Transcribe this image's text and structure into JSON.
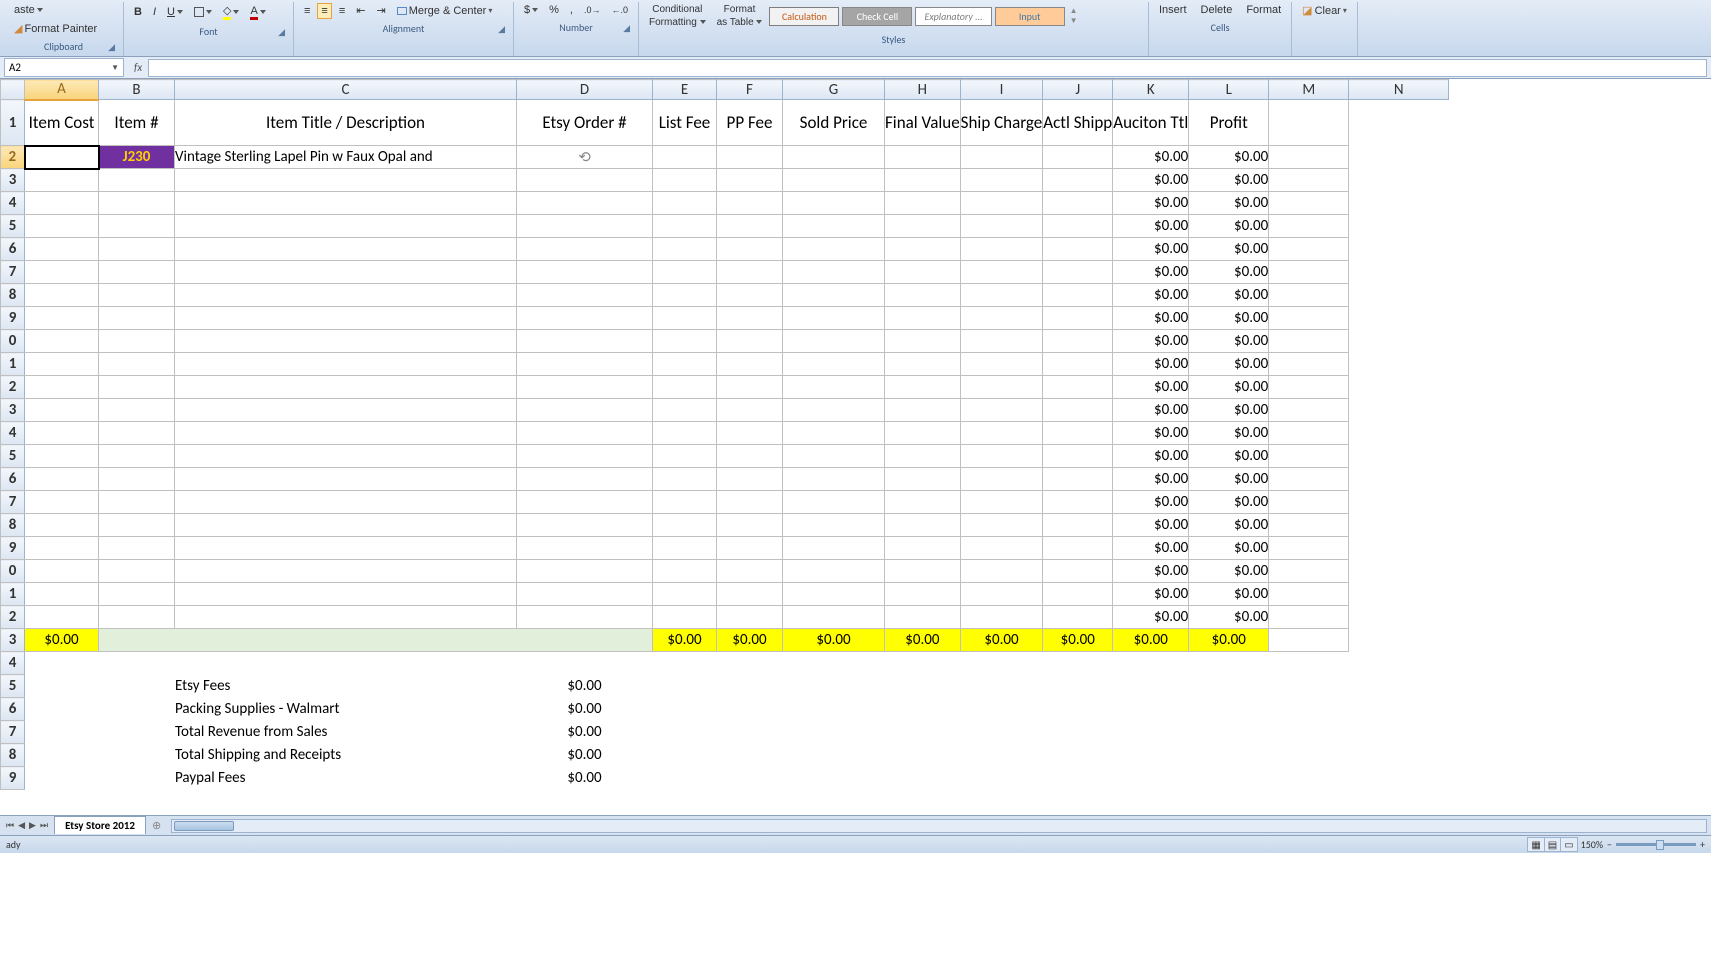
{
  "ribbon": {
    "paste": "aste",
    "format_painter": "Format Painter",
    "clipboard": "Clipboard",
    "font": "Font",
    "alignment": "Alignment",
    "merge_center": "Merge & Center",
    "number": "Number",
    "cond_fmt_l1": "Conditional",
    "cond_fmt_l2": "Formatting",
    "fmt_table_l1": "Format",
    "fmt_table_l2": "as Table",
    "style_calc": "Calculation",
    "style_check": "Check Cell",
    "style_explan": "Explanatory ...",
    "style_input": "Input",
    "styles": "Styles",
    "insert": "Insert",
    "delete": "Delete",
    "format": "Format",
    "cells": "Cells",
    "clear": "Clear"
  },
  "name_box": "A2",
  "columns": [
    "A",
    "B",
    "C",
    "D",
    "E",
    "F",
    "G",
    "H",
    "I",
    "J",
    "K",
    "L",
    "M",
    "N"
  ],
  "headers": {
    "A": "Item Cost",
    "B": "Item #",
    "C": "Item Title / Description",
    "D": "Etsy Order #",
    "E": "List Fee",
    "F": "PP Fee",
    "G": "Sold Price",
    "H": "Final Value",
    "I": "Ship Charge",
    "J": "Actl Shipp",
    "K": "Auciton Ttl",
    "L": "Profit"
  },
  "row2": {
    "B": "J230",
    "C": "Vintage Sterling Lapel Pin w Faux Opal and"
  },
  "zero": "$0.00",
  "totals_row": {
    "A": "$0.00"
  },
  "summary": [
    {
      "label": "Etsy Fees",
      "val": "$0.00"
    },
    {
      "label": "Packing Supplies - Walmart",
      "val": "$0.00"
    },
    {
      "label": "Total Revenue from Sales",
      "val": "$0.00"
    },
    {
      "label": "Total Shipping and Receipts",
      "val": "$0.00"
    },
    {
      "label": "Paypal Fees",
      "val": "$0.00"
    }
  ],
  "sheet_tab": "Etsy Store 2012",
  "status": "ady",
  "zoom": "150%"
}
